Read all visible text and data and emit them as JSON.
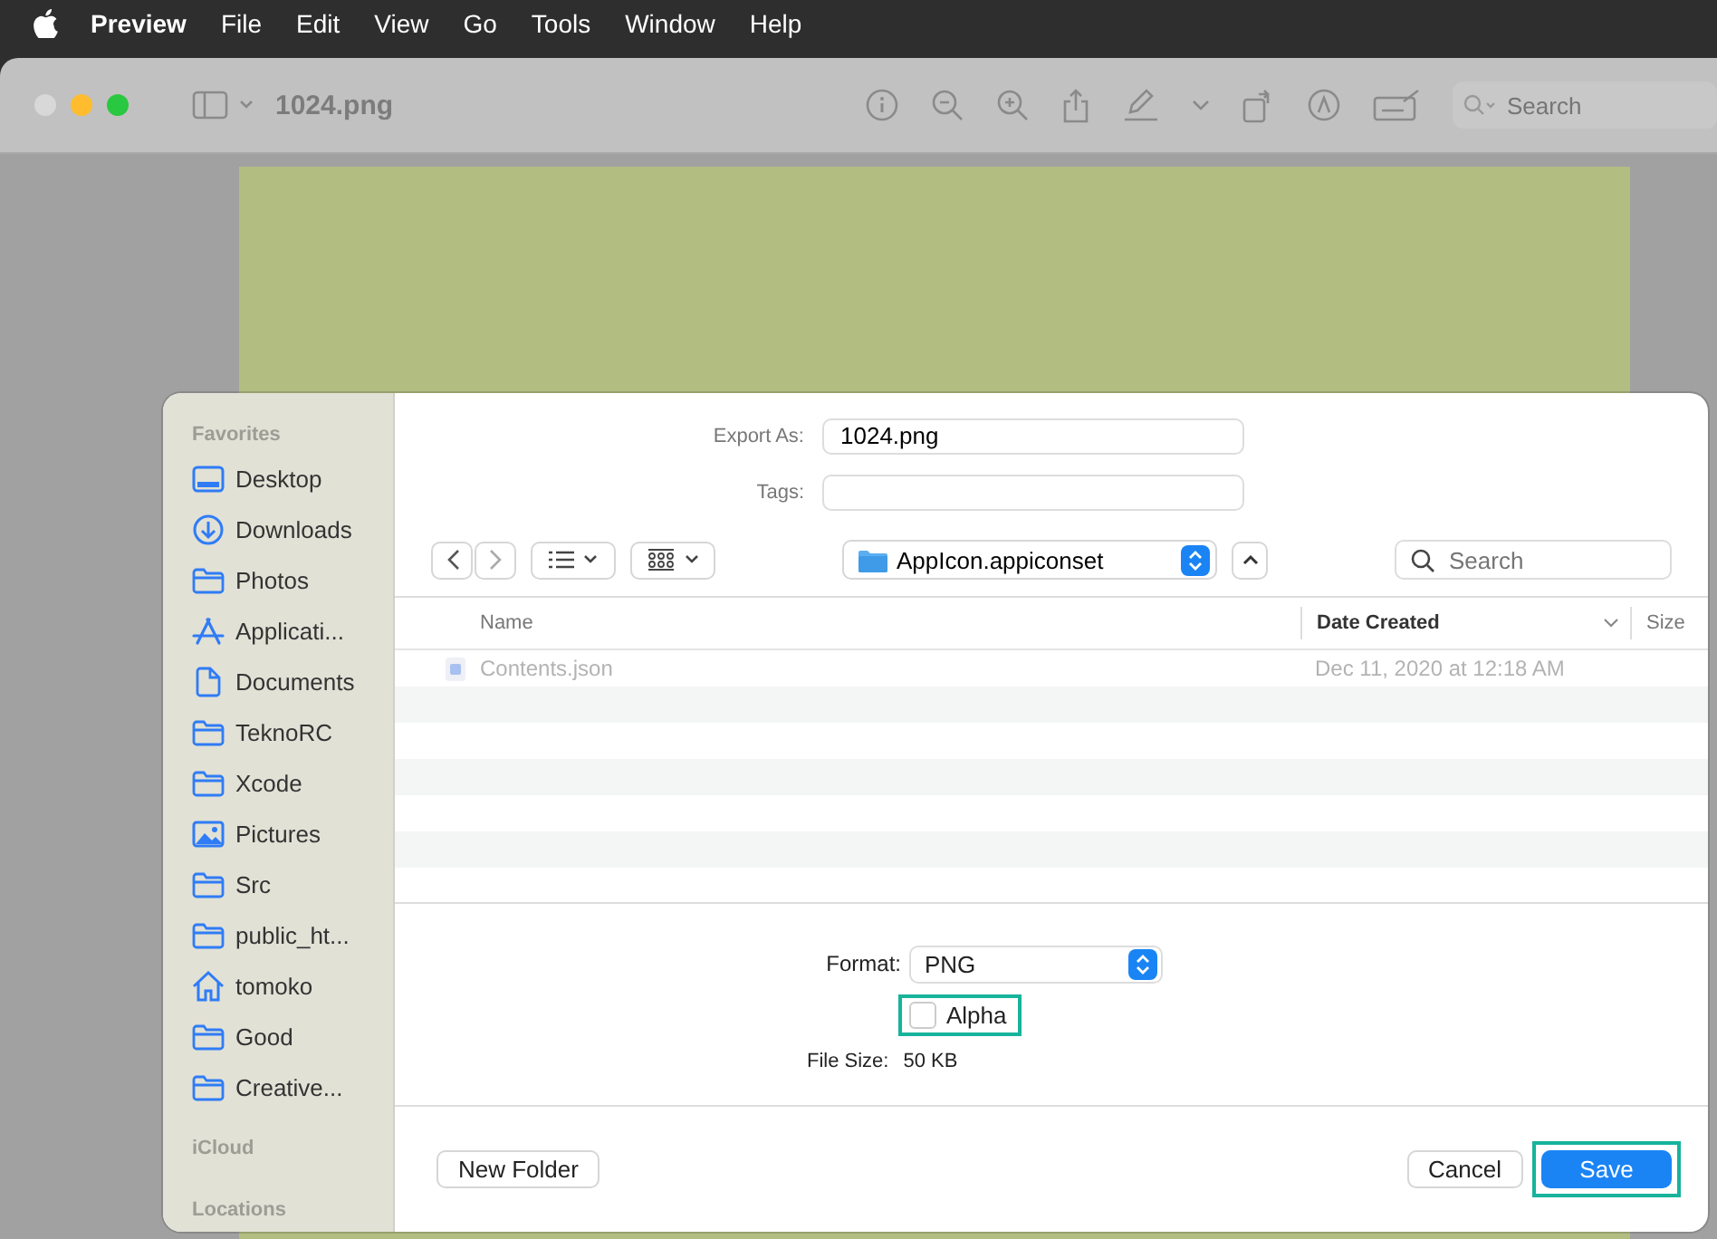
{
  "menu_bar": {
    "app": "Preview",
    "items": [
      "File",
      "Edit",
      "View",
      "Go",
      "Tools",
      "Window",
      "Help"
    ]
  },
  "window": {
    "title": "1024.png",
    "search": {
      "placeholder": "Search"
    }
  },
  "dialog": {
    "sidebar": {
      "sections": [
        {
          "title": "Favorites",
          "items": [
            {
              "label": "Desktop",
              "kind": "desktop"
            },
            {
              "label": "Downloads",
              "kind": "download"
            },
            {
              "label": "Photos",
              "kind": "folder"
            },
            {
              "label": "Applicati...",
              "kind": "app"
            },
            {
              "label": "Documents",
              "kind": "document"
            },
            {
              "label": "TeknoRC",
              "kind": "folder"
            },
            {
              "label": "Xcode",
              "kind": "folder"
            },
            {
              "label": "Pictures",
              "kind": "picture"
            },
            {
              "label": "Src",
              "kind": "folder"
            },
            {
              "label": "public_ht...",
              "kind": "folder"
            },
            {
              "label": "tomoko",
              "kind": "home"
            },
            {
              "label": "Good",
              "kind": "folder"
            },
            {
              "label": "Creative...",
              "kind": "folder"
            }
          ]
        },
        {
          "title": "iCloud"
        },
        {
          "title": "Locations"
        }
      ]
    },
    "export_as": {
      "label": "Export As:",
      "value": "1024.png"
    },
    "tags": {
      "label": "Tags:"
    },
    "location": "AppIcon.appiconset",
    "search": {
      "placeholder": "Search"
    },
    "table": {
      "columns": [
        {
          "label": "Name",
          "sorted": false
        },
        {
          "label": "Date Created",
          "sorted": true
        },
        {
          "label": "Size",
          "sorted": false
        }
      ],
      "rows": [
        {
          "name": "Contents.json",
          "date": "Dec 11, 2020 at 12:18 AM",
          "disabled": true
        }
      ]
    },
    "format": {
      "label": "Format:",
      "value": "PNG"
    },
    "alpha": {
      "label": "Alpha",
      "checked": false,
      "highlighted": true
    },
    "file_size": {
      "label": "File Size:",
      "value": "50 KB"
    },
    "buttons": [
      {
        "label": "New Folder",
        "kind": "plain",
        "highlighted": false
      },
      {
        "label": "Cancel",
        "kind": "plain",
        "highlighted": false
      },
      {
        "label": "Save",
        "kind": "default",
        "highlighted": true
      }
    ]
  }
}
